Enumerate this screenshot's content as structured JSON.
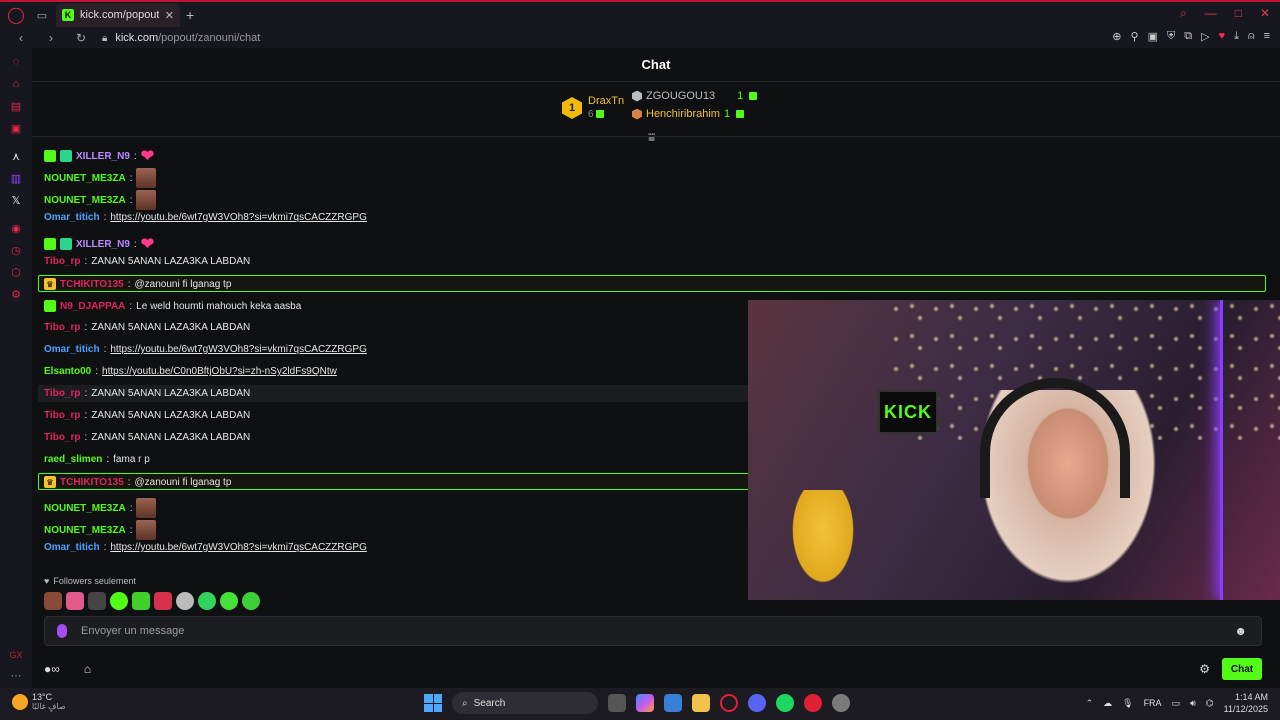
{
  "browser": {
    "tab_title": "kick.com/popout/zanouni",
    "url_host": "kick.com",
    "url_path": "/popout/zanouni/chat"
  },
  "chat": {
    "title": "Chat",
    "leaderboard": {
      "first": {
        "rank": "1",
        "name": "DraxTn",
        "count": "6"
      },
      "second": {
        "name": "ZGOUGOU13",
        "count": "1"
      },
      "third": {
        "name": "Henchiribrahim",
        "count": "1"
      }
    },
    "messages": [
      {
        "user": "XILLER_N9",
        "text": "",
        "color": "#b98bff",
        "emote": "heart",
        "badges": [
          "green",
          "gift"
        ]
      },
      {
        "user": "NOUNET_ME3ZA",
        "text": "",
        "color": "#53fc18",
        "emote": "face",
        "badges": []
      },
      {
        "user": "NOUNET_ME3ZA",
        "text": "",
        "color": "#53fc18",
        "emote": "face",
        "badges": []
      },
      {
        "user": "Omar_titich",
        "text": "https://youtu.be/6wt7gW3VOh8?si=vkmi7qsCACZZRGPG",
        "color": "#4aa3ff",
        "link": true,
        "badges": []
      },
      {
        "user": "XILLER_N9",
        "text": "",
        "color": "#b98bff",
        "emote": "heart",
        "badges": [
          "green",
          "gift"
        ]
      },
      {
        "user": "Tibo_rp",
        "text": "ZANAN 5ANAN LAZA3KA LABDAN",
        "color": "#e0245e",
        "badges": []
      },
      {
        "user": "TCHIKITO135",
        "text": "@zanouni fi lganag tp",
        "color": "#e0245e",
        "highlight": true,
        "badges": [
          "crown"
        ]
      },
      {
        "user": "N9_DJAPPAA",
        "text": "Le weld houmti mahouch keka aasba",
        "color": "#e0245e",
        "badges": [
          "green"
        ]
      },
      {
        "user": "Tibo_rp",
        "text": "ZANAN 5ANAN LAZA3KA LABDAN",
        "color": "#e0245e",
        "badges": []
      },
      {
        "user": "Omar_titich",
        "text": "https://youtu.be/6wt7gW3VOh8?si=vkmi7qsCACZZRGPG",
        "color": "#4aa3ff",
        "link": true,
        "badges": []
      },
      {
        "user": "Elsanto00",
        "text": "https://youtu.be/C0n0BftjObU?si=zh-nSy2ldFs9QNtw",
        "color": "#53fc18",
        "link": true,
        "badges": []
      },
      {
        "user": "Tibo_rp",
        "text": "ZANAN 5ANAN LAZA3KA LABDAN",
        "color": "#e0245e",
        "hover": true,
        "badges": []
      },
      {
        "user": "Tibo_rp",
        "text": "ZANAN 5ANAN LAZA3KA LABDAN",
        "color": "#e0245e",
        "badges": []
      },
      {
        "user": "Tibo_rp",
        "text": "ZANAN 5ANAN LAZA3KA LABDAN",
        "color": "#e0245e",
        "badges": []
      },
      {
        "user": "raed_slimen",
        "text": "fama r p",
        "color": "#53fc18",
        "badges": []
      },
      {
        "user": "TCHIKITO135",
        "text": "@zanouni fi lganag tp",
        "color": "#e0245e",
        "highlight": true,
        "badges": [
          "crown"
        ]
      },
      {
        "user": "NOUNET_ME3ZA",
        "text": "",
        "color": "#53fc18",
        "emote": "face",
        "badges": []
      },
      {
        "user": "NOUNET_ME3ZA",
        "text": "",
        "color": "#53fc18",
        "emote": "face",
        "badges": []
      },
      {
        "user": "Omar_titich",
        "text": "https://youtu.be/6wt7gW3VOh8?si=vkmi7qsCACZZRGPG",
        "color": "#4aa3ff",
        "link": true,
        "badges": []
      }
    ],
    "followers_only": "Followers seulement",
    "input_placeholder": "Envoyer un message",
    "send_label": "Chat",
    "video_sign": "KICK"
  },
  "taskbar": {
    "temperature": "13°C",
    "condition": "صافٍ غالبًا",
    "search_label": "Search",
    "language": "FRA",
    "time": "1:14 AM",
    "date": "11/12/2025"
  },
  "colors": {
    "accent": "#53fc18",
    "opera": "#e02035"
  }
}
